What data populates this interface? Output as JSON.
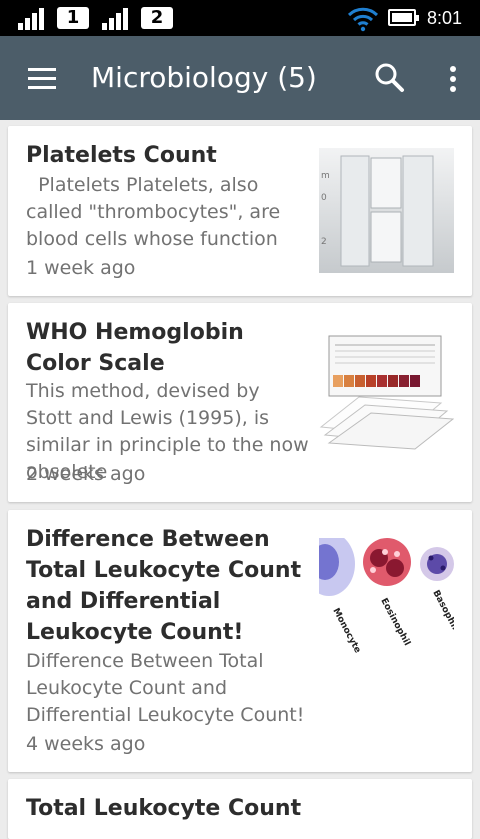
{
  "status_bar": {
    "sim1_label": "1",
    "sim2_label": "2",
    "time": "8:01"
  },
  "app_bar": {
    "title": "Microbiology (5)",
    "color": "#4c5d69"
  },
  "articles": [
    {
      "title": "Platelets Count",
      "snippet": "  Platelets Platelets, also called \"thrombocytes\", are blood cells whose function",
      "time": "1 week ago",
      "thumbnail_icon": "counting-chamber-image"
    },
    {
      "title": "WHO Hemoglobin Color Scale",
      "snippet": "This method, devised by Stott and Lewis (1995), is similar in principle to the now obsolete",
      "time": "2 weeks ago",
      "thumbnail_icon": "hemoglobin-color-scale-image"
    },
    {
      "title": "Difference Between Total Leukocyte Count and Differential Leukocyte Count!",
      "snippet": "Difference Between Total Leukocyte Count and Differential Leukocyte Count!",
      "time": "4 weeks ago",
      "thumbnail_icon": "leukocytes-image",
      "thumbnail_labels": [
        "Monocyte",
        "Eosinophil",
        "Basophil"
      ]
    },
    {
      "title": "Total Leukocyte Count"
    }
  ]
}
